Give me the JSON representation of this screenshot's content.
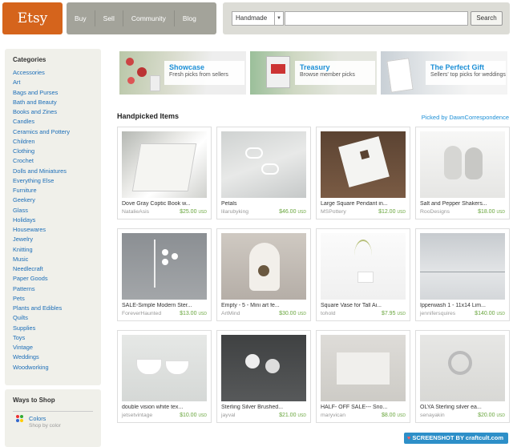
{
  "header": {
    "logo": "Etsy",
    "nav": [
      "Buy",
      "Sell",
      "Community",
      "Blog"
    ],
    "search": {
      "select_value": "Handmade",
      "button": "Search",
      "placeholder": ""
    }
  },
  "sidebar": {
    "title": "Categories",
    "categories": [
      "Accessories",
      "Art",
      "Bags and Purses",
      "Bath and Beauty",
      "Books and Zines",
      "Candles",
      "Ceramics and Pottery",
      "Children",
      "Clothing",
      "Crochet",
      "Dolls and Miniatures",
      "Everything Else",
      "Furniture",
      "Geekery",
      "Glass",
      "Holidays",
      "Housewares",
      "Jewelry",
      "Knitting",
      "Music",
      "Needlecraft",
      "Paper Goods",
      "Patterns",
      "Pets",
      "Plants and Edibles",
      "Quilts",
      "Supplies",
      "Toys",
      "Vintage",
      "Weddings",
      "Woodworking"
    ],
    "ways": {
      "title": "Ways to Shop",
      "colors_label": "Colors",
      "colors_sub": "Shop by color"
    }
  },
  "banners": [
    {
      "title": "Showcase",
      "subtitle": "Fresh picks from sellers"
    },
    {
      "title": "Treasury",
      "subtitle": "Browse member picks"
    },
    {
      "title": "The Perfect Gift",
      "subtitle": "Sellers' top picks for weddings"
    }
  ],
  "handpicked": {
    "title": "Handpicked Items",
    "picked_by": "Picked by DawnCorrespondence",
    "items": [
      {
        "title": "Dove Gray Coptic Book w...",
        "seller": "NatalieAsis",
        "price": "$25.00",
        "currency": "USD"
      },
      {
        "title": "Petals",
        "seller": "lilarubyking",
        "price": "$46.00",
        "currency": "USD"
      },
      {
        "title": "Large Square Pendant in...",
        "seller": "MSPottery",
        "price": "$12.00",
        "currency": "USD"
      },
      {
        "title": "Salt and Pepper Shakers...",
        "seller": "RooDesigns",
        "price": "$18.00",
        "currency": "USD"
      },
      {
        "title": "SALE-Simple Modern Ster...",
        "seller": "ForeverHaunted",
        "price": "$13.00",
        "currency": "USD"
      },
      {
        "title": "Empty - 5 - Mini art fe...",
        "seller": "ArtMind",
        "price": "$30.00",
        "currency": "USD"
      },
      {
        "title": "Square Vase for Tall Ai...",
        "seller": "tohold",
        "price": "$7.95",
        "currency": "USD"
      },
      {
        "title": "Ipperwash 1 - 11x14 Lim...",
        "seller": "jennifersquires",
        "price": "$140.00",
        "currency": "USD"
      },
      {
        "title": "double vision white tex...",
        "seller": "jetsetvintage",
        "price": "$10.00",
        "currency": "USD"
      },
      {
        "title": "Sterling Silver Brushed...",
        "seller": "jayval",
        "price": "$21.00",
        "currency": "USD"
      },
      {
        "title": "HALF- OFF SALE--- Sno...",
        "seller": "maryvican",
        "price": "$8.00",
        "currency": "USD"
      },
      {
        "title": "OLYA Sterling silver ea...",
        "seller": "senayakin",
        "price": "$20.00",
        "currency": "USD"
      }
    ]
  },
  "watermark": "SCREENSHOT BY craftcult.com"
}
